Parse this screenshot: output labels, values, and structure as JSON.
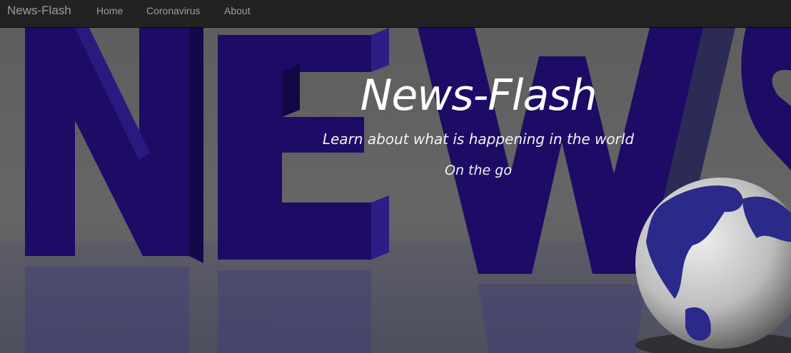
{
  "navbar": {
    "brand": "News-Flash",
    "links": [
      "Home",
      "Coronavirus",
      "About"
    ]
  },
  "hero": {
    "title": "News-Flash",
    "subtitle": "Learn about what is happening in the world",
    "tagline": "On the go"
  },
  "colors": {
    "navbar_bg": "#222222",
    "nav_text": "#9d9d9d",
    "letters": "#1c0a6a",
    "hero_text": "#ffffff"
  },
  "icons": [
    "globe-icon"
  ]
}
